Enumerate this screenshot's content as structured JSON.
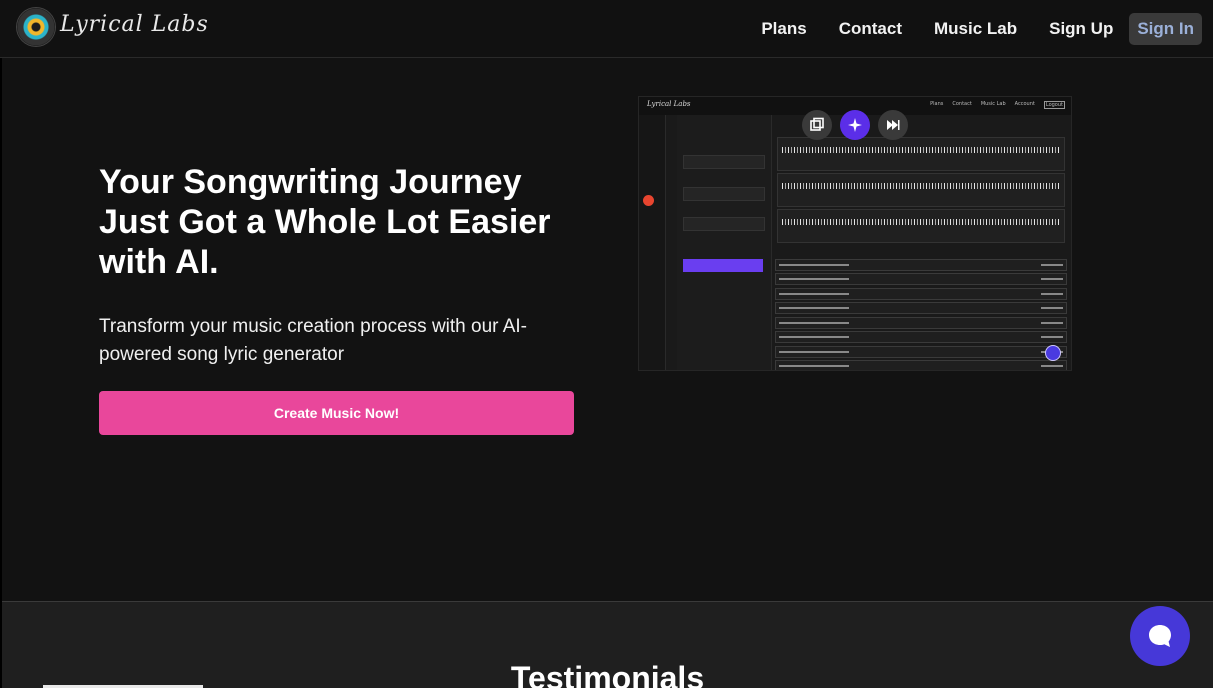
{
  "brand": {
    "name": "Lyrical Labs"
  },
  "nav": {
    "items": [
      {
        "label": "Plans"
      },
      {
        "label": "Contact"
      },
      {
        "label": "Music Lab"
      },
      {
        "label": "Sign Up"
      }
    ],
    "sign_in_label": "Sign In"
  },
  "hero": {
    "title": "Your Songwriting Journey Just Got a Whole Lot Easier with AI.",
    "subtitle": "Transform your music creation process with our AI-powered song lyric generator",
    "cta_label": "Create Music Now!"
  },
  "preview": {
    "brand": "Lyrical Labs",
    "nav": [
      "Plans",
      "Contact",
      "Music Lab",
      "Account",
      "Logout"
    ]
  },
  "testimonials": {
    "heading": "Testimonials"
  },
  "colors": {
    "background": "#121212",
    "cta": "#e9479b",
    "sign_in_bg": "#3a3a3a",
    "sign_in_text": "#9bb0d8",
    "chat_widget": "#4638d8"
  },
  "icons": {
    "logo": "vinyl-record-logo-icon",
    "chat": "chat-bubble-icon",
    "copy": "copy-icon",
    "sparkle": "sparkle-icon",
    "skip": "skip-forward-icon"
  }
}
